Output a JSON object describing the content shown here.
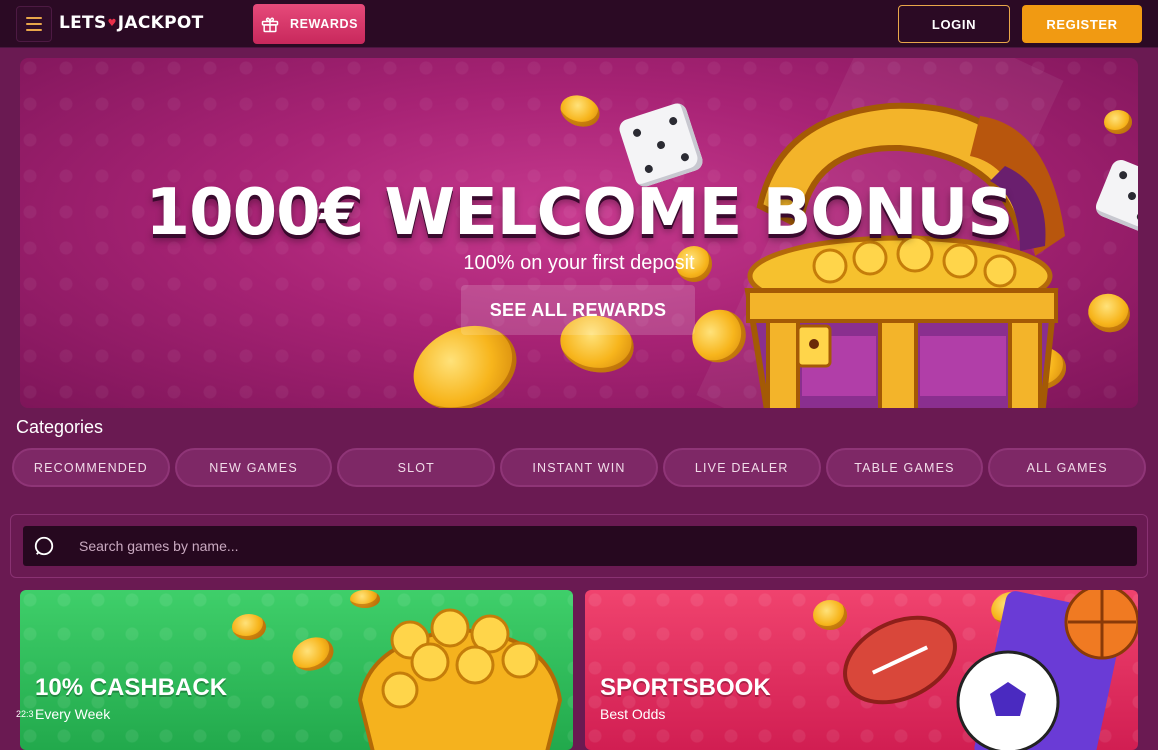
{
  "header": {
    "logo_text_left": "LETS",
    "logo_text_right": "JACKPOT",
    "rewards_label": "REWARDS",
    "login_label": "LOGIN",
    "register_label": "REGISTER"
  },
  "hero": {
    "title": "1000€ WELCOME BONUS",
    "subtitle": "100% on your first deposit",
    "cta_label": "SEE ALL REWARDS"
  },
  "categories": {
    "heading": "Categories",
    "items": [
      {
        "label": "RECOMMENDED"
      },
      {
        "label": "NEW GAMES"
      },
      {
        "label": "SLOT"
      },
      {
        "label": "INSTANT WIN"
      },
      {
        "label": "LIVE DEALER"
      },
      {
        "label": "TABLE GAMES"
      },
      {
        "label": "ALL GAMES"
      }
    ]
  },
  "search": {
    "placeholder": "Search games by name..."
  },
  "promos": [
    {
      "title": "10% CASHBACK",
      "subtitle": "Every Week"
    },
    {
      "title": "SPORTSBOOK",
      "subtitle": "Best Odds"
    }
  ],
  "overlay_time": "22:3",
  "colors": {
    "topbar_bg": "#2b0a24",
    "page_bg": "#6a1a52",
    "accent_orange": "#f19a12",
    "rewards_pink": "#d8346a",
    "cashback_green": "#2fbd5a",
    "sportsbook_pink": "#e2315f"
  },
  "icons": {
    "menu": "hamburger-icon",
    "rewards": "gift-icon",
    "search": "search-icon"
  }
}
